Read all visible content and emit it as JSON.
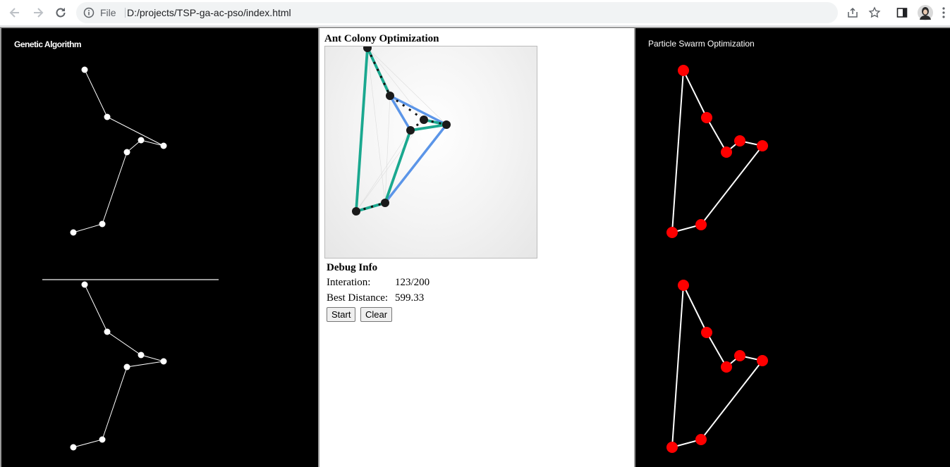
{
  "browser": {
    "scheme": "File",
    "url": "D:/projects/TSP-ga-ac-pso/index.html"
  },
  "ga": {
    "title": "Genetic Algorithm"
  },
  "aco": {
    "title": "Ant Colony Optimization",
    "debug_title": "Debug Info",
    "iteration_label": "Interation:",
    "iteration_value": "123/200",
    "best_label": "Best Distance:",
    "best_value": "599.33",
    "start_label": "Start",
    "clear_label": "Clear"
  },
  "pso": {
    "title": "Particle Swarm Optimization"
  },
  "colors": {
    "ga_bg": "#000000",
    "ga_point": "#ffffff",
    "pso_point": "#ff0000",
    "aco_best": "#1aa88f",
    "aco_alt": "#5b95e8"
  }
}
